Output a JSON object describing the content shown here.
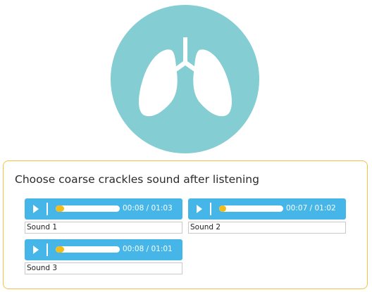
{
  "question": "Choose coarse crackles sound after listening",
  "colors": {
    "hero_circle": "#84cdd3",
    "player_bg": "#45b6e7",
    "progress": "#f2bd1b",
    "border": "#f2c442"
  },
  "hero_icon": "lungs-icon",
  "options": [
    {
      "label": "Sound 1",
      "time": "00:08 / 01:03",
      "progress": 0.13
    },
    {
      "label": "Sound 2",
      "time": "00:07 / 01:02",
      "progress": 0.11
    },
    {
      "label": "Sound 3",
      "time": "00:08 / 01:01",
      "progress": 0.13
    }
  ]
}
